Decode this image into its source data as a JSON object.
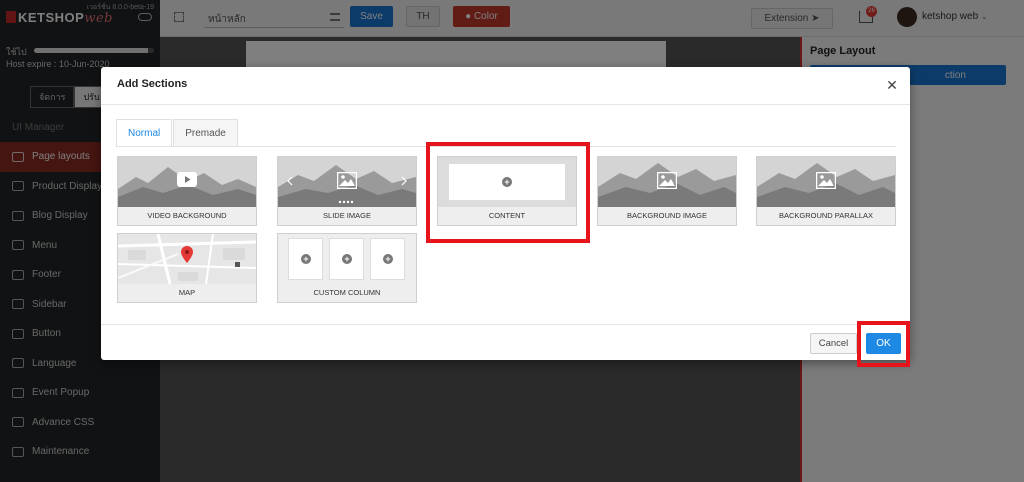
{
  "colors": {
    "highlight": "#e8141b",
    "primary": "#1e88e5",
    "sidebar_active": "#8b2b22",
    "color_button": "#c0392b"
  },
  "sidebar": {
    "brand": "KETSHOP",
    "brand_suffix": "web",
    "version": "เวอร์ชั่น 8.0.0-beta-19",
    "usage_label": "ใช้ไป",
    "usage_fraction": 0.95,
    "expire": "Host expire : 10-Jun-2020",
    "mode_tabs": [
      "จัดการ",
      "ปรับ"
    ],
    "section_title": "UI Manager",
    "items": [
      {
        "label": "Page layouts",
        "icon": "layout-icon"
      },
      {
        "label": "Product Display",
        "icon": "product-icon"
      },
      {
        "label": "Blog Display",
        "icon": "blog-icon"
      },
      {
        "label": "Menu",
        "icon": "menu-icon"
      },
      {
        "label": "Footer",
        "icon": "footer-icon"
      },
      {
        "label": "Sidebar",
        "icon": "sidebar-icon"
      },
      {
        "label": "Button",
        "icon": "toggle-icon"
      },
      {
        "label": "Language",
        "icon": "language-icon"
      },
      {
        "label": "Event Popup",
        "icon": "popup-icon"
      },
      {
        "label": "Advance CSS",
        "icon": "css-icon"
      },
      {
        "label": "Maintenance",
        "icon": "bug-icon"
      }
    ]
  },
  "toolbar": {
    "page_select": "หน้าหลัก",
    "save_label": "Save",
    "lang_label": "TH",
    "color_label": "Color",
    "extension_label": "Extension",
    "cart_count": "26",
    "user_name": "ketshop web"
  },
  "right_panel": {
    "title": "Page Layout",
    "button_label": "ction"
  },
  "modal": {
    "title": "Add Sections",
    "tabs": [
      "Normal",
      "Premade"
    ],
    "active_tab": "Normal",
    "sections": [
      {
        "label": "VIDEO BACKGROUND",
        "thumb": "video"
      },
      {
        "label": "SLIDE IMAGE",
        "thumb": "slide"
      },
      {
        "label": "CONTENT",
        "thumb": "content"
      },
      {
        "label": "BACKGROUND IMAGE",
        "thumb": "image"
      },
      {
        "label": "BACKGROUND PARALLAX",
        "thumb": "parallax"
      },
      {
        "label": "MAP",
        "thumb": "map"
      },
      {
        "label": "CUSTOM COLUMN",
        "thumb": "columns"
      }
    ],
    "cancel_label": "Cancel",
    "ok_label": "OK"
  }
}
